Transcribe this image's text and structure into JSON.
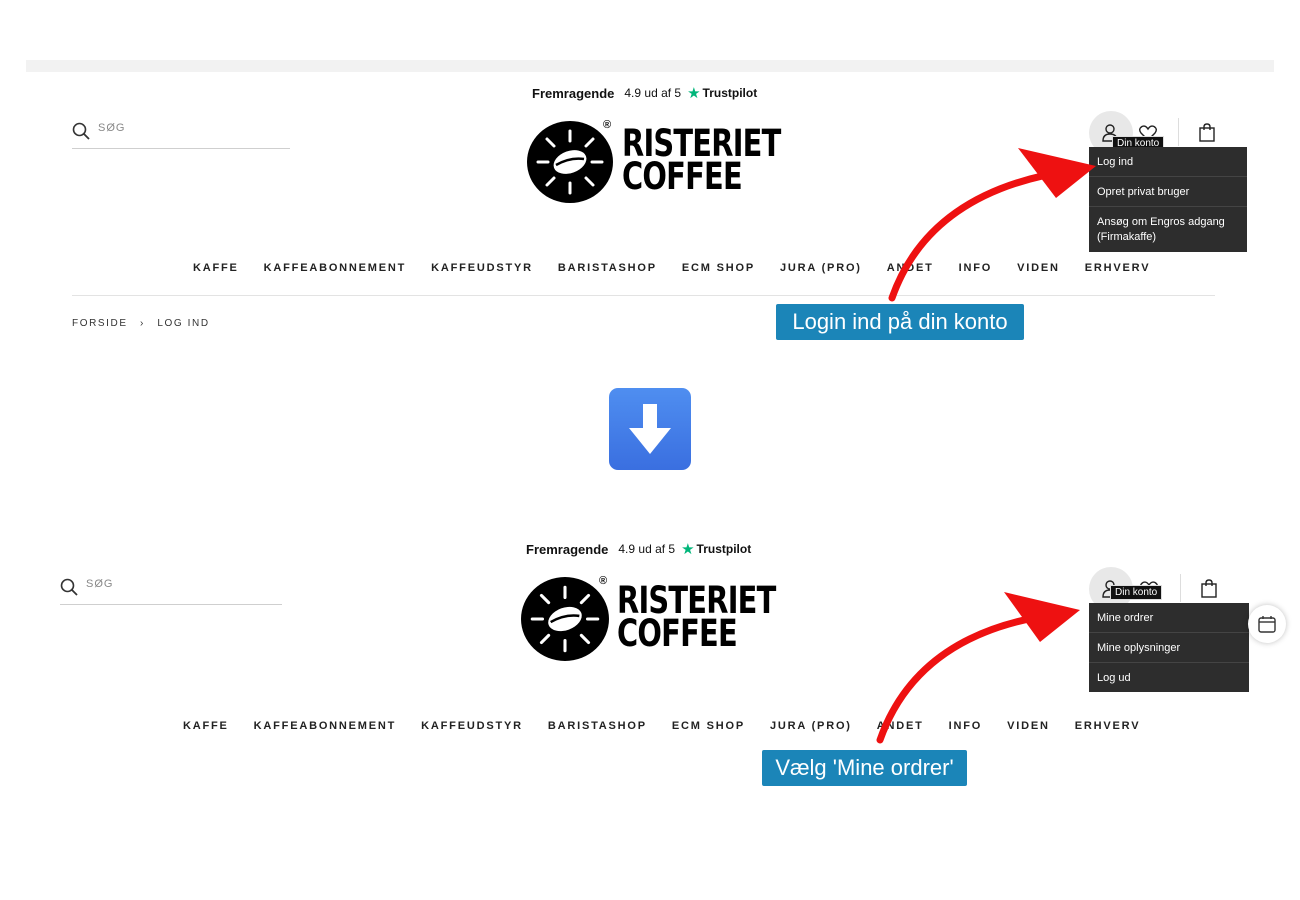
{
  "colors": {
    "callout_bg": "#1b85b8",
    "annotation_arrow": "#ee1111",
    "trustpilot_star": "#00b67a",
    "dropdown_bg": "#2d2d2d",
    "step_arrow": "#3a6fe0"
  },
  "trustpilot": {
    "rating_label": "Fremragende",
    "score": "4.9 ud af 5",
    "brand": "Trustpilot",
    "star_icon": "star-icon"
  },
  "search": {
    "placeholder": "SØG",
    "icon": "search-icon"
  },
  "logo": {
    "line1": "RISTERIET",
    "line2": "COFFEE",
    "registered": "®",
    "emblem_icon": "coffee-bean-sun-icon"
  },
  "nav": [
    "KAFFE",
    "KAFFEABONNEMENT",
    "KAFFEUDSTYR",
    "BARISTASHOP",
    "ECM SHOP",
    "JURA (PRO)",
    "ANDET",
    "INFO",
    "VIDEN",
    "ERHVERV"
  ],
  "breadcrumb": {
    "home": "FORSIDE",
    "separator": "›",
    "current": "LOG IND"
  },
  "header_icons": [
    "user-icon",
    "heart-icon",
    "bag-icon"
  ],
  "step1": {
    "tooltip": "Din konto",
    "menu": [
      "Log ind",
      "Opret privat bruger",
      "Ansøg om Engros adgang (Firmakaffe)"
    ],
    "callout": "Login ind på din konto"
  },
  "step_arrow_icon": "arrow-down-icon",
  "step2": {
    "tooltip": "Din konto",
    "menu": [
      "Mine ordrer",
      "Mine oplysninger",
      "Log ud"
    ],
    "callout": "Vælg 'Mine ordrer'",
    "calendar_icon": "calendar-icon"
  }
}
